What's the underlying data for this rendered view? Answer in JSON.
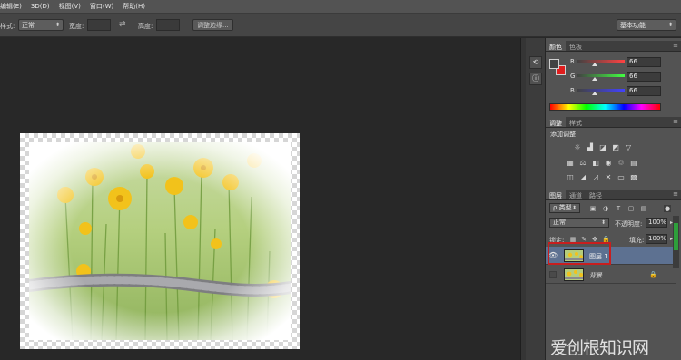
{
  "menu": {
    "items": [
      "编辑(E)",
      "3D(D)",
      "视图(V)",
      "窗口(W)",
      "帮助(H)"
    ]
  },
  "options_bar": {
    "style_label": "样式:",
    "style_value": "正常",
    "width_label": "宽度:",
    "swap_icon": "swap-arrows-icon",
    "height_label": "高度:",
    "refine_edge_button": "调整边缘...",
    "workspace_select": "基本功能"
  },
  "color_panel": {
    "tabs": [
      "颜色",
      "色板"
    ],
    "fg_color": "#424242",
    "bg_color": "#e01e1e",
    "sliders": [
      {
        "label": "R",
        "value": "66"
      },
      {
        "label": "G",
        "value": "66"
      },
      {
        "label": "B",
        "value": "66"
      }
    ]
  },
  "adjustments_panel": {
    "tabs": [
      "调整",
      "样式"
    ],
    "title": "添加调整",
    "icons_row1": [
      "brightness-icon",
      "levels-icon",
      "curves-icon",
      "exposure-icon",
      "vibrance-triangle-icon"
    ],
    "icons_row2": [
      "hue-saturation-icon",
      "color-balance-icon",
      "black-white-icon",
      "photo-filter-icon",
      "channel-mixer-icon",
      "color-lookup-icon"
    ],
    "icons_row3": [
      "invert-icon",
      "posterize-icon",
      "threshold-icon",
      "selective-color-icon",
      "gradient-map-icon"
    ]
  },
  "layers_panel": {
    "tabs": [
      "图层",
      "通道",
      "路径"
    ],
    "filter_select": "ρ 类型",
    "blend_mode": "正常",
    "opacity_label": "不透明度:",
    "opacity_value": "100%",
    "lock_label": "锁定:",
    "fill_label": "填充:",
    "fill_value": "100%",
    "layers": [
      {
        "name": "图层 1",
        "visible": true,
        "selected": true
      },
      {
        "name": "背景",
        "visible": false,
        "selected": false,
        "locked": true
      }
    ]
  },
  "watermark": "爱创根知识网"
}
